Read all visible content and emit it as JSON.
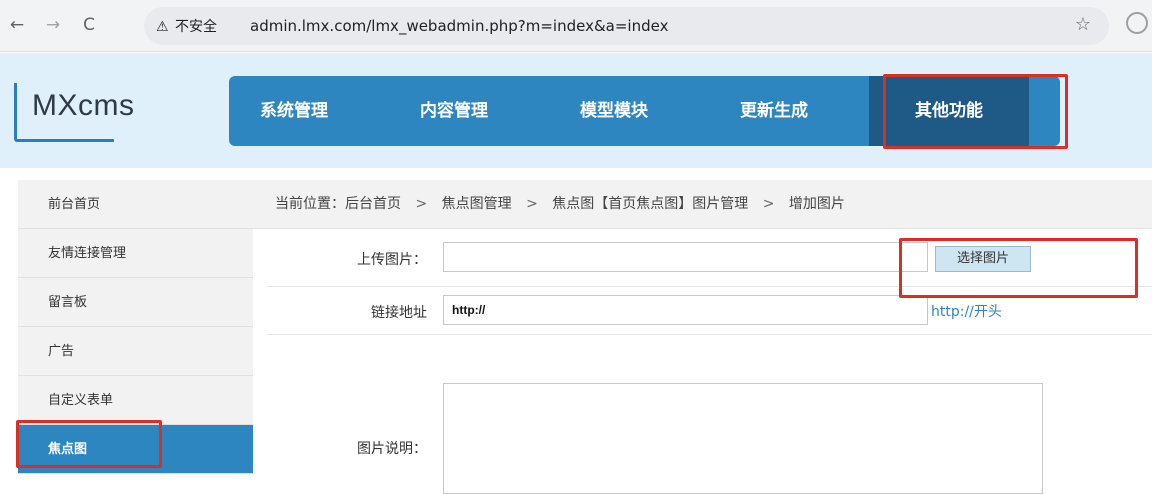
{
  "browser": {
    "back_icon": "←",
    "forward_icon": "→",
    "reload_icon": "C",
    "security_icon": "⚠",
    "security_label": "不安全",
    "url": "admin.lmx.com/lmx_webadmin.php?m=index&a=index",
    "star_icon": "☆"
  },
  "header": {
    "logo": "MXcms",
    "nav": [
      "系统管理",
      "内容管理",
      "模型模块",
      "更新生成",
      "其他功能"
    ],
    "active_nav": "其他功能"
  },
  "sidebar": {
    "items": [
      "前台首页",
      "友情连接管理",
      "留言板",
      "广告",
      "自定义表单",
      "焦点图"
    ],
    "active_item": "焦点图"
  },
  "breadcrumb": {
    "prefix": "当前位置：后台首页",
    "sep": ">",
    "items": [
      "焦点图管理",
      "焦点图【首页焦点图】图片管理",
      "增加图片"
    ]
  },
  "form": {
    "upload_label": "上传图片：",
    "upload_value": "",
    "upload_button": "选择图片",
    "link_label": "链接地址",
    "link_value": "http://",
    "link_hint": "http://开头",
    "desc_label": "图片说明："
  },
  "colors": {
    "accent": "#2e86c1",
    "active_nav": "#1f5a86",
    "highlight_box": "#d93025"
  }
}
